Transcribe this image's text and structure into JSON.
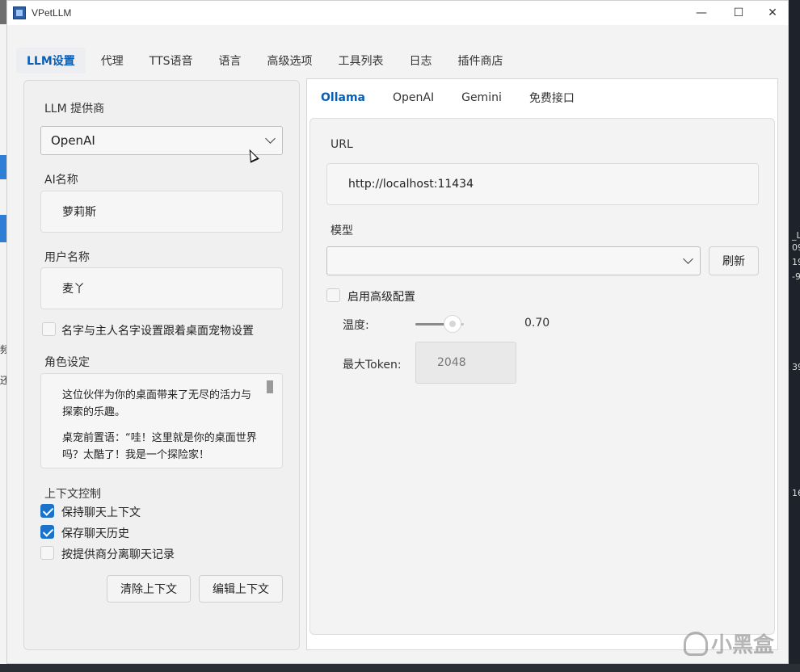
{
  "window": {
    "title": "VPetLLM",
    "minimize_glyph": "—",
    "maximize_glyph": "☐",
    "close_glyph": "✕"
  },
  "top_tabs": [
    "LLM设置",
    "代理",
    "TTS语音",
    "语言",
    "高级选项",
    "工具列表",
    "日志",
    "插件商店"
  ],
  "left": {
    "provider_label": "LLM 提供商",
    "provider_value": "OpenAI",
    "ai_name_label": "AI名称",
    "ai_name_value": "萝莉斯",
    "user_name_label": "用户名称",
    "user_name_value": "麦丫",
    "sync_name_label": "名字与主人名字设置跟着桌面宠物设置",
    "role_label": "角色设定",
    "role_text_1": "这位伙伴为你的桌面带来了无尽的活力与探索的乐趣。",
    "role_text_2": "桌宠前置语：“哇！这里就是你的桌面世界吗？太酷了！我是一个探险家！",
    "context_label": "上下文控制",
    "keep_context_label": "保持聊天上下文",
    "save_history_label": "保存聊天历史",
    "separate_by_provider_label": "按提供商分离聊天记录",
    "clear_button": "清除上下文",
    "edit_button": "编辑上下文"
  },
  "right": {
    "sub_tabs": [
      "Ollama",
      "OpenAI",
      "Gemini",
      "免费接口"
    ],
    "url_label": "URL",
    "url_value": "http://localhost:11434",
    "model_label": "模型",
    "model_value": "",
    "refresh_button": "刷新",
    "advanced_label": "启用高级配置",
    "temperature_label": "温度:",
    "temperature_value": "0.70",
    "max_token_label": "最大Token:",
    "max_token_value": "2048"
  },
  "state": {
    "sync_name_checked": false,
    "keep_context_checked": true,
    "save_history_checked": true,
    "separate_by_provider_checked": false,
    "advanced_checked": false
  },
  "background": {
    "left_chars": [
      "频",
      "还"
    ],
    "right_chars": [
      "_L",
      "09",
      "19",
      "-9",
      "39",
      "16"
    ]
  },
  "watermark": "小黑盒",
  "colors": {
    "accent": "#0a5fb4",
    "checkbox_on": "#1a73c8"
  }
}
